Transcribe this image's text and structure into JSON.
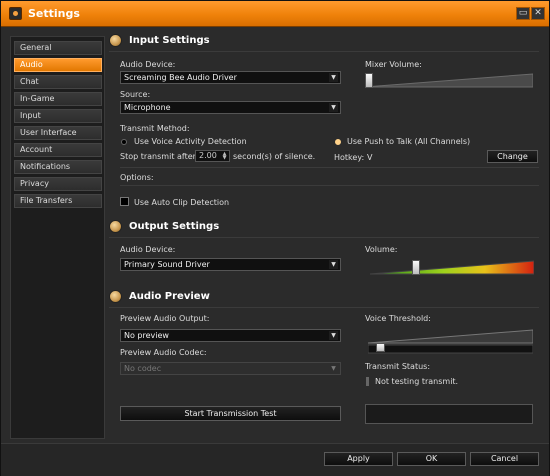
{
  "window": {
    "title": "Settings",
    "minimize_glyph": "▭",
    "close_glyph": "✕"
  },
  "sidebar": {
    "items": [
      {
        "label": "General"
      },
      {
        "label": "Audio"
      },
      {
        "label": "Chat"
      },
      {
        "label": "In-Game"
      },
      {
        "label": "Input"
      },
      {
        "label": "User Interface"
      },
      {
        "label": "Account"
      },
      {
        "label": "Notifications"
      },
      {
        "label": "Privacy"
      },
      {
        "label": "File Transfers"
      }
    ],
    "active": "Audio"
  },
  "input_settings": {
    "title": "Input Settings",
    "audio_device_label": "Audio Device:",
    "audio_device_value": "Screaming Bee Audio Driver",
    "source_label": "Source:",
    "source_value": "Microphone",
    "mixer_volume_label": "Mixer Volume:",
    "mixer_volume_level": 0.0,
    "transmit_method_label": "Transmit Method:",
    "voice_activity_label": "Use Voice Activity Detection",
    "push_to_talk_label": "Use Push to Talk (All Channels)",
    "selected_transmit": "push_to_talk",
    "stop_transmit_label": "Stop transmit after:",
    "stop_transmit_value": "2.00",
    "seconds_label": "second(s) of silence.",
    "hotkey_label": "Hotkey:",
    "hotkey_value": "V",
    "change_button": "Change",
    "options_label": "Options:",
    "auto_clip_label": "Use Auto Clip Detection",
    "auto_clip_checked": false
  },
  "output_settings": {
    "title": "Output Settings",
    "audio_device_label": "Audio Device:",
    "audio_device_value": "Primary Sound Driver",
    "volume_label": "Volume:",
    "volume_level": 0.27
  },
  "audio_preview": {
    "title": "Audio Preview",
    "preview_output_label": "Preview Audio Output:",
    "preview_output_value": "No preview",
    "preview_codec_label": "Preview Audio Codec:",
    "preview_codec_value": "No codec",
    "voice_threshold_label": "Voice Threshold:",
    "voice_threshold_level": 0.05,
    "transmit_status_label": "Transmit Status:",
    "transmit_status_value": "Not testing transmit.",
    "start_test_button": "Start Transmission Test"
  },
  "footer": {
    "apply": "Apply",
    "ok": "OK",
    "cancel": "Cancel"
  },
  "colors": {
    "accent": "#f0820a",
    "panel": "#2b2b2b",
    "field": "#101010"
  },
  "icons": {
    "section": "speaker-icon",
    "app": "app-logo-icon"
  }
}
